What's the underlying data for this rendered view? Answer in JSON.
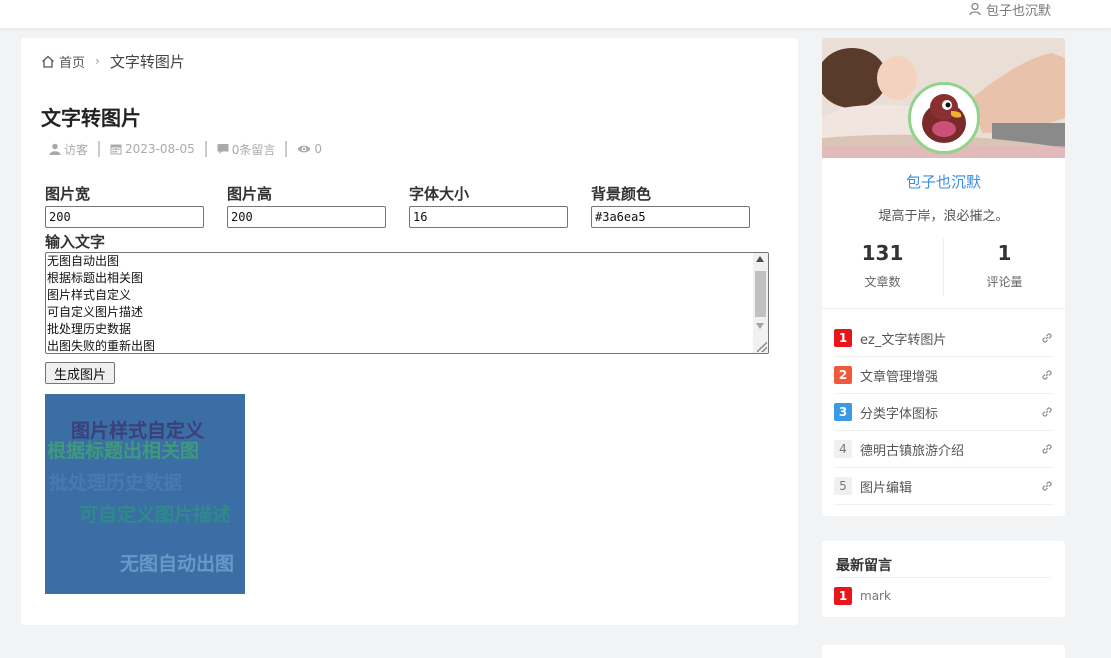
{
  "topbar": {
    "user_name": "包子也沉默",
    "icon": "user-icon"
  },
  "breadcrumb": {
    "home": "首页",
    "separator": "›",
    "current": "文字转图片"
  },
  "post": {
    "title": "文字转图片",
    "meta": {
      "author": "访客",
      "date": "2023-08-05",
      "comments": "0条留言",
      "views": "0"
    }
  },
  "form": {
    "fields": [
      {
        "label": "图片宽",
        "value": "200"
      },
      {
        "label": "图片高",
        "value": "200"
      },
      {
        "label": "字体大小",
        "value": "16"
      },
      {
        "label": "背景颜色",
        "value": "#3a6ea5"
      }
    ],
    "text_label": "输入文字",
    "text_lines": [
      "无图自动出图",
      "根据标题出相关图",
      "图片样式自定义",
      "可自定义图片描述",
      "批处理历史数据",
      "出图失败的重新出图"
    ],
    "generate_label": "生成图片"
  },
  "output_image": {
    "background": "#3a6ea5",
    "texts": [
      "图片样式自定义",
      "根据标题出相关图",
      "批处理历史数据",
      "可自定义图片描述",
      "无图自动出图"
    ],
    "text_colors": [
      "#3b3f7a",
      "#3e9a7a",
      "#4a78b0",
      "#2f8a8a",
      "#6a98c8"
    ]
  },
  "sidebar": {
    "author": "包子也沉默",
    "motto": "堤高于岸，浪必摧之。",
    "stats": [
      {
        "value": "131",
        "label": "文章数"
      },
      {
        "value": "1",
        "label": "评论量"
      }
    ],
    "ranking": [
      {
        "rank": "1",
        "title": "ez_文字转图片",
        "color": "#e8161b"
      },
      {
        "rank": "2",
        "title": "文章管理增强",
        "color": "#f05a3a"
      },
      {
        "rank": "3",
        "title": "分类字体图标",
        "color": "#3a9ae6"
      },
      {
        "rank": "4",
        "title": "德明古镇旅游介绍",
        "color": ""
      },
      {
        "rank": "5",
        "title": "图片编辑",
        "color": ""
      }
    ]
  },
  "recent_comments": {
    "title": "最新留言",
    "items": [
      {
        "rank": "1",
        "text": "mark"
      }
    ]
  }
}
